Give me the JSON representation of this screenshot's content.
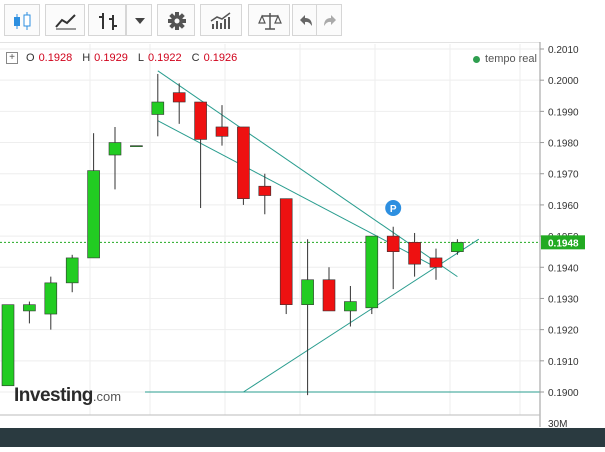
{
  "toolbar": {
    "buttons": [
      {
        "name": "candlestick-chart-button",
        "icon": "candlestick-icon"
      },
      {
        "name": "area-chart-button",
        "icon": "area-chart-icon"
      },
      {
        "name": "bar-chart-type-button",
        "icon": "ohlc-bars-icon"
      },
      {
        "name": "chart-type-dropdown-button",
        "icon": "caret-down-icon"
      },
      {
        "name": "settings-button",
        "icon": "gear-icon"
      },
      {
        "name": "indicators-button",
        "icon": "indicators-icon"
      },
      {
        "name": "compare-button",
        "icon": "scale-icon"
      },
      {
        "name": "undo-button",
        "icon": "undo-icon"
      },
      {
        "name": "redo-button",
        "icon": "redo-icon"
      }
    ]
  },
  "ohlc": {
    "o_label": "O",
    "o_value": "0.1928",
    "h_label": "H",
    "h_value": "0.1929",
    "l_label": "L",
    "l_value": "0.1922",
    "c_label": "C",
    "c_value": "0.1926"
  },
  "realtime_label": "tempo real",
  "logo": {
    "text": "Investing",
    "suffix": ".com"
  },
  "colors": {
    "up": "#22cc22",
    "down": "#ee1111",
    "trendline": "#2a9d8f",
    "current_price_line": "#22aa22",
    "price_tag_bg": "#22aa22",
    "marker": "#2d8fe0"
  },
  "marker_label": "P",
  "volume_label": "30M",
  "chart_data": {
    "type": "candlestick",
    "y_range": [
      0.1895,
      0.2013
    ],
    "y_ticks": [
      "0.2010",
      "0.2000",
      "0.1990",
      "0.1980",
      "0.1970",
      "0.1960",
      "0.1950",
      "0.1940",
      "0.1930",
      "0.1920",
      "0.1910",
      "0.1900"
    ],
    "current_price": "0.1948",
    "candles": [
      {
        "o": 0.1902,
        "h": 0.1928,
        "l": 0.1902,
        "c": 0.1928
      },
      {
        "o": 0.1926,
        "h": 0.1929,
        "l": 0.1922,
        "c": 0.1928
      },
      {
        "o": 0.1925,
        "h": 0.1937,
        "l": 0.192,
        "c": 0.1935
      },
      {
        "o": 0.1935,
        "h": 0.1944,
        "l": 0.1932,
        "c": 0.1943
      },
      {
        "o": 0.1943,
        "h": 0.1983,
        "l": 0.1943,
        "c": 0.1971
      },
      {
        "o": 0.1976,
        "h": 0.1985,
        "l": 0.1965,
        "c": 0.198
      },
      {
        "o": 0.1979,
        "h": 0.1979,
        "l": 0.1979,
        "c": 0.1979
      },
      {
        "o": 0.1989,
        "h": 0.2002,
        "l": 0.1982,
        "c": 0.1993
      },
      {
        "o": 0.1996,
        "h": 0.1999,
        "l": 0.1986,
        "c": 0.1993
      },
      {
        "o": 0.1993,
        "h": 0.1993,
        "l": 0.1959,
        "c": 0.1981
      },
      {
        "o": 0.1985,
        "h": 0.1992,
        "l": 0.1979,
        "c": 0.1982
      },
      {
        "o": 0.1985,
        "h": 0.1985,
        "l": 0.196,
        "c": 0.1962
      },
      {
        "o": 0.1966,
        "h": 0.197,
        "l": 0.1957,
        "c": 0.1963
      },
      {
        "o": 0.1962,
        "h": 0.1962,
        "l": 0.1925,
        "c": 0.1928
      },
      {
        "o": 0.1928,
        "h": 0.1949,
        "l": 0.1899,
        "c": 0.1936
      },
      {
        "o": 0.1936,
        "h": 0.194,
        "l": 0.1926,
        "c": 0.1926
      },
      {
        "o": 0.1926,
        "h": 0.1934,
        "l": 0.1921,
        "c": 0.1929
      },
      {
        "o": 0.1927,
        "h": 0.195,
        "l": 0.1925,
        "c": 0.195
      },
      {
        "o": 0.195,
        "h": 0.1953,
        "l": 0.1933,
        "c": 0.1945
      },
      {
        "o": 0.1948,
        "h": 0.1951,
        "l": 0.1937,
        "c": 0.1941
      },
      {
        "o": 0.1943,
        "h": 0.1946,
        "l": 0.1936,
        "c": 0.194
      },
      {
        "o": 0.1945,
        "h": 0.1949,
        "l": 0.1944,
        "c": 0.1948
      }
    ],
    "trendlines": [
      {
        "from": [
          7,
          0.2003
        ],
        "to": [
          21,
          0.1937
        ]
      },
      {
        "from": [
          7,
          0.1987
        ],
        "to": [
          20,
          0.194
        ]
      },
      {
        "from": [
          11,
          0.19
        ],
        "to": [
          22,
          0.1949
        ]
      }
    ],
    "support_level": 0.19
  }
}
